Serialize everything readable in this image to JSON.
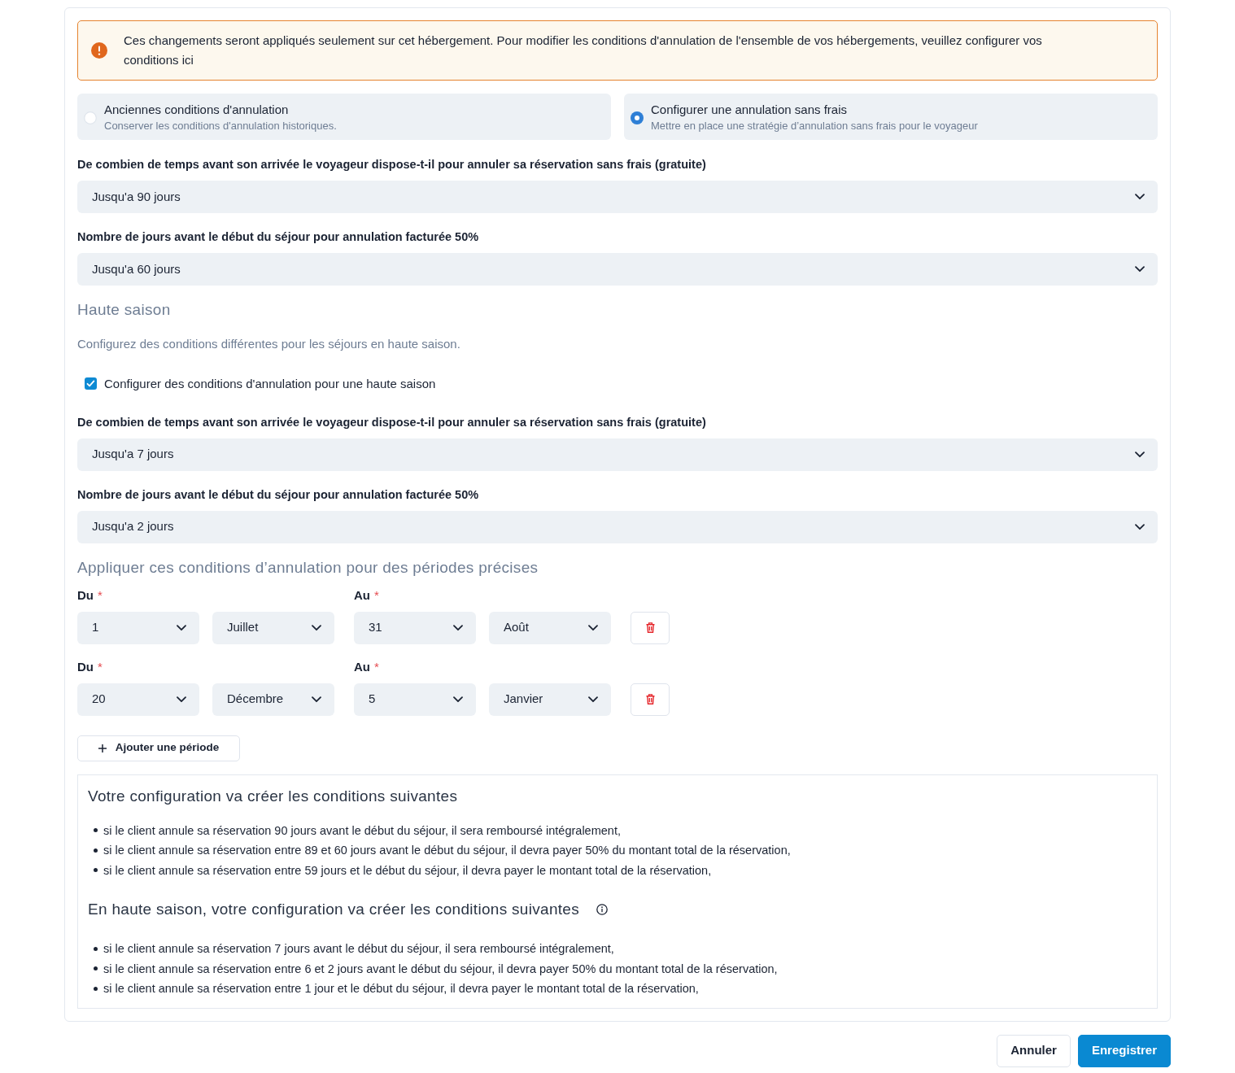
{
  "alert": {
    "text": "Ces changements seront appliqués seulement sur cet hébergement. Pour modifier les conditions d'annulation de l'ensemble de vos hébergements, veuillez configurer vos conditions ici"
  },
  "options": [
    {
      "title": "Anciennes conditions d'annulation",
      "description": "Conserver les conditions d'annulation historiques.",
      "selected": false
    },
    {
      "title": "Configurer une annulation sans frais",
      "description": "Mettre en place une stratégie d’annulation sans frais pour le voyageur",
      "selected": true
    }
  ],
  "fields": [
    {
      "label": "De combien de temps avant son arrivée le voyageur dispose-t-il pour annuler sa réservation sans frais (gratuite)",
      "value": "Jusqu'a 90 jours"
    },
    {
      "label": "Nombre de jours avant le début du séjour pour annulation facturée 50%",
      "value": "Jusqu'a 60 jours"
    }
  ],
  "high_season": {
    "title": "Haute saison",
    "description": "Configurez des conditions différentes pour les séjours en haute saison.",
    "checkbox": {
      "label": "Configurer des conditions d'annulation pour une haute saison",
      "checked": true
    },
    "fields": [
      {
        "label": "De combien de temps avant son arrivée le voyageur dispose-t-il pour annuler sa réservation sans frais (gratuite)",
        "value": "Jusqu'a 7 jours"
      },
      {
        "label": "Nombre de jours avant le début du séjour pour annulation facturée 50%",
        "value": "Jusqu'a 2 jours"
      }
    ],
    "periods_title": "Appliquer ces conditions d’annulation pour des périodes précises",
    "periods": [
      {
        "from": {
          "label": "Du",
          "required": "*",
          "day": "1",
          "month": "Juillet"
        },
        "to": {
          "label": "Au",
          "required": "*",
          "day": "31",
          "month": "Août"
        }
      },
      {
        "from": {
          "label": "Du",
          "required": "*",
          "day": "20",
          "month": "Décembre"
        },
        "to": {
          "label": "Au",
          "required": "*",
          "day": "5",
          "month": "Janvier"
        }
      }
    ],
    "add_button": "Ajouter une période"
  },
  "summary": [
    {
      "title": "Votre configuration va créer les conditions suivantes",
      "info": false,
      "items": [
        "si le client annule sa réservation 90 jours avant le début du séjour, il sera remboursé intégralement,",
        "si le client annule sa réservation entre 89 et 60 jours avant le début du séjour, il devra payer 50% du montant total de la réservation,",
        "si le client annule sa réservation entre 59 jours et le début du séjour, il devra payer le montant total de la réservation,"
      ]
    },
    {
      "title": "En haute saison, votre configuration va créer les conditions suivantes",
      "info": true,
      "items": [
        "si le client annule sa réservation 7 jours avant le début du séjour, il sera remboursé intégralement,",
        "si le client annule sa réservation entre 6 et 2 jours avant le début du séjour, il devra payer 50% du montant total de la réservation,",
        "si le client annule sa réservation entre 1 jour et le début du séjour, il devra payer le montant total de la réservation,"
      ]
    }
  ],
  "buttons": [
    {
      "label": "Annuler",
      "kind": "secondary"
    },
    {
      "label": "Enregistrer",
      "kind": "primary"
    }
  ]
}
